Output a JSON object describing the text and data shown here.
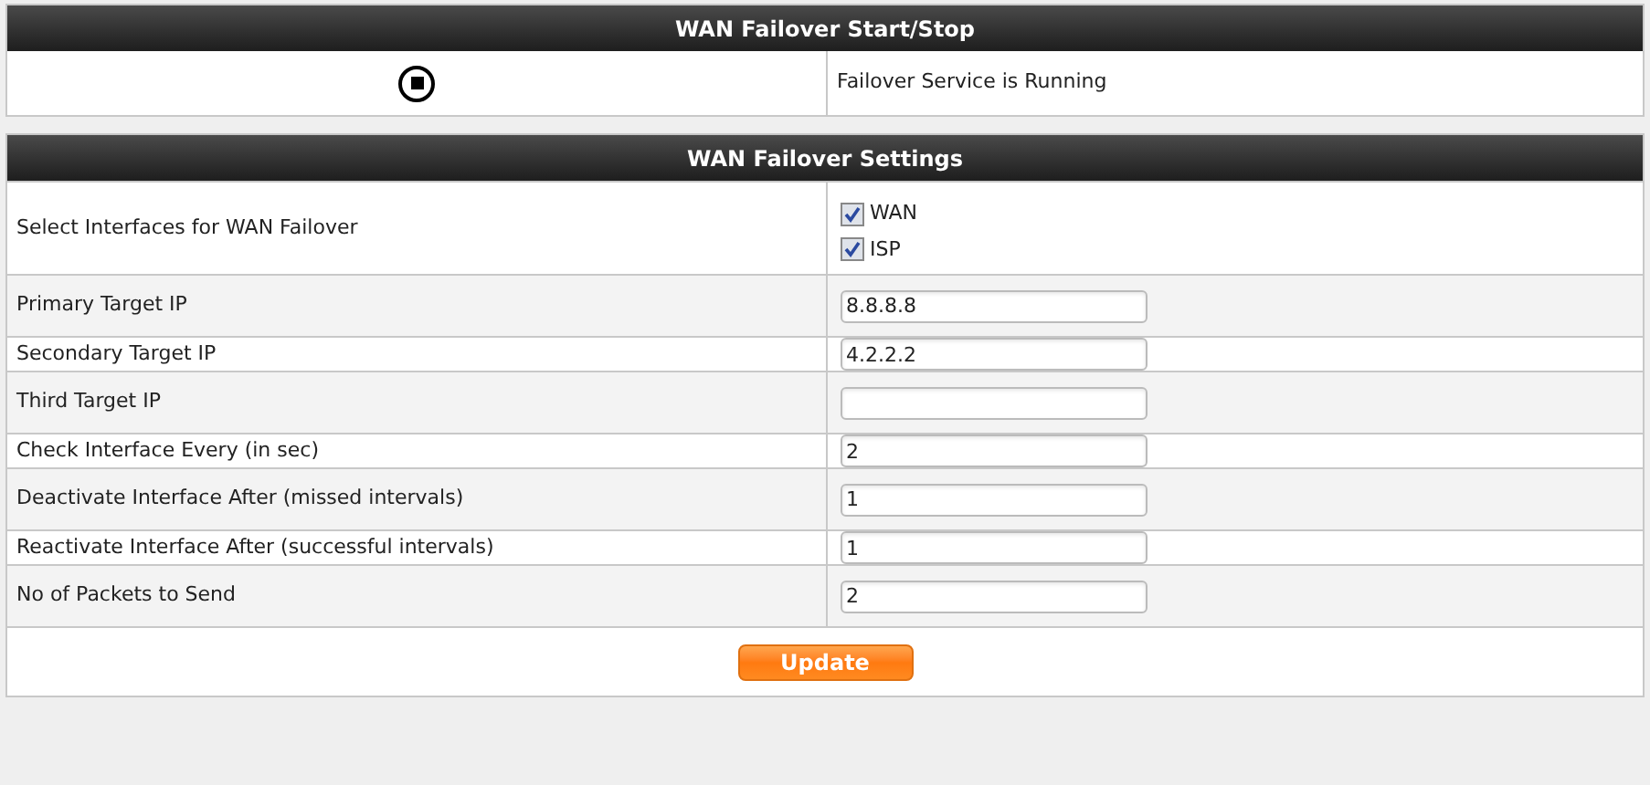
{
  "start_stop": {
    "title": "WAN Failover Start/Stop",
    "running": true,
    "status": "Failover Service is Running"
  },
  "settings": {
    "title": "WAN Failover Settings",
    "rows": [
      {
        "kind": "checkboxes",
        "label": "Select Interfaces for WAN Failover",
        "options": [
          {
            "label": "WAN",
            "checked": true
          },
          {
            "label": "ISP",
            "checked": true
          }
        ]
      },
      {
        "kind": "input",
        "label": "Primary Target IP",
        "value": "8.8.8.8"
      },
      {
        "kind": "input",
        "label": "Secondary Target IP",
        "value": "4.2.2.2"
      },
      {
        "kind": "input",
        "label": "Third Target IP"
      },
      {
        "kind": "input",
        "label": "Check Interface Every (in sec)",
        "value": "2"
      },
      {
        "kind": "input",
        "label": "Deactivate Interface After (missed intervals)",
        "value": "1"
      },
      {
        "kind": "input",
        "label": "Reactivate Interface After (successful intervals)",
        "value": "1"
      },
      {
        "kind": "input",
        "label": "No of Packets to Send",
        "value": "2"
      }
    ],
    "button": "Update"
  }
}
